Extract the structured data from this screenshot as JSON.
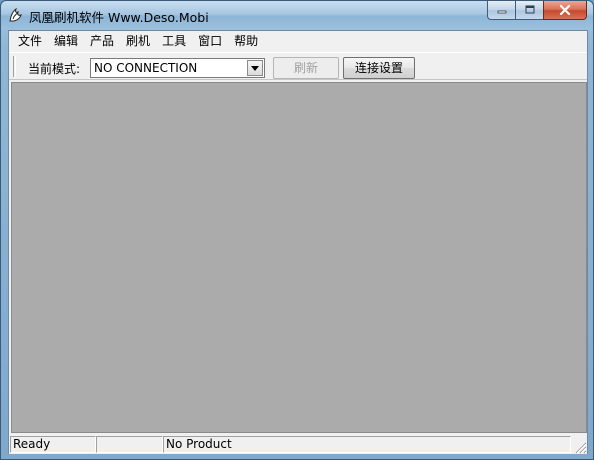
{
  "window": {
    "title": "凤凰刷机软件 Www.Deso.Mobi",
    "icon": "phoenix-logo-icon",
    "controls": {
      "minimize": "minimize-icon",
      "maximize": "maximize-icon",
      "close": "close-icon"
    }
  },
  "menu": {
    "items": [
      {
        "label": "文件"
      },
      {
        "label": "编辑"
      },
      {
        "label": "产品"
      },
      {
        "label": "刷机"
      },
      {
        "label": "工具"
      },
      {
        "label": "窗口"
      },
      {
        "label": "帮助"
      }
    ]
  },
  "toolbar": {
    "mode_label": "当前模式:",
    "mode_value": "NO CONNECTION",
    "refresh_label": "刷新",
    "refresh_enabled": false,
    "connect_settings_label": "连接设置"
  },
  "statusbar": {
    "pane1": "Ready",
    "pane2": "",
    "pane3": "No Product"
  },
  "colors": {
    "mdi_background": "#ababab",
    "chrome": "#f0f0f0",
    "title_gradient_top": "#c8ddef",
    "close_button": "#c54a2e",
    "disabled_text": "#a0a0a0"
  }
}
